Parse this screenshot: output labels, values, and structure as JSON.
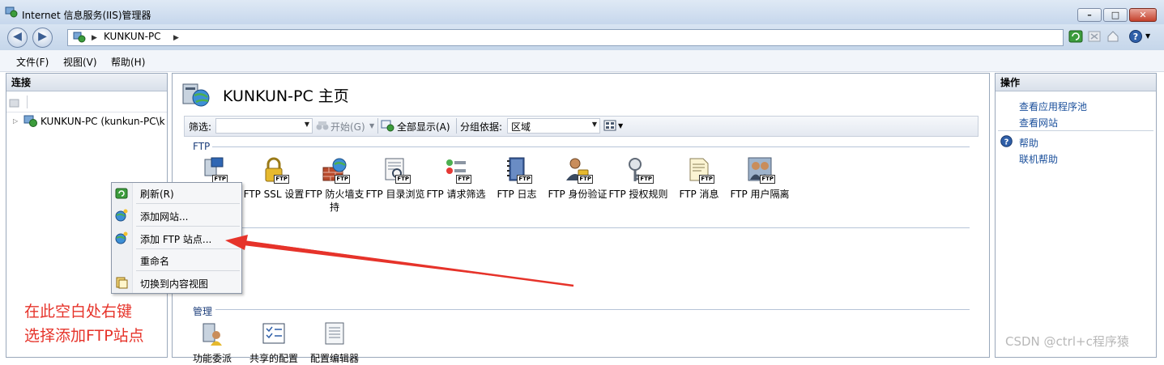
{
  "window": {
    "title": "Internet 信息服务(IIS)管理器",
    "minimize_glyph": "–",
    "maximize_glyph": "□",
    "close_glyph": "✕"
  },
  "address_bar": {
    "separator": "▶",
    "path": "KUNKUN-PC",
    "trailing_separator": "▶"
  },
  "menu": [
    {
      "label": "文件(F)"
    },
    {
      "label": "视图(V)"
    },
    {
      "label": "帮助(H)"
    }
  ],
  "connections": {
    "header": "连接",
    "tree_root": "KUNKUN-PC (kunkun-PC\\kunkun)"
  },
  "center": {
    "title": "KUNKUN-PC 主页",
    "filter_label": "筛选:",
    "filter_value": "",
    "start_label": "开始(G)",
    "show_all_label": "全部显示(A)",
    "group_by_label": "分组依据:",
    "group_by_value": "区域",
    "sections": [
      {
        "label": "FTP",
        "features": [
          {
            "label": "",
            "icon": "ftp-site-icon"
          },
          {
            "label": "FTP SSL 设置",
            "icon": "lock-icon"
          },
          {
            "label": "FTP 防火墙支持",
            "icon": "firewall-icon"
          },
          {
            "label": "FTP 目录浏览",
            "icon": "directory-browse-icon"
          },
          {
            "label": "FTP 请求筛选",
            "icon": "request-filter-icon"
          },
          {
            "label": "FTP 日志",
            "icon": "log-book-icon"
          },
          {
            "label": "FTP 身份验证",
            "icon": "user-lock-icon"
          },
          {
            "label": "FTP 授权规则",
            "icon": "key-icon"
          },
          {
            "label": "FTP 消息",
            "icon": "message-icon"
          },
          {
            "label": "FTP 用户隔离",
            "icon": "user-isolation-icon"
          }
        ]
      },
      {
        "label": "管理",
        "features": [
          {
            "label": "功能委派",
            "icon": "delegation-icon"
          },
          {
            "label": "共享的配置",
            "icon": "shared-config-icon"
          },
          {
            "label": "配置编辑器",
            "icon": "config-editor-icon"
          }
        ]
      }
    ]
  },
  "context_menu": {
    "items": [
      {
        "label": "刷新(R)",
        "icon": "refresh-icon"
      },
      {
        "label": "添加网站...",
        "icon": "add-website-icon"
      },
      {
        "label": "添加 FTP 站点...",
        "icon": "add-ftp-site-icon"
      },
      {
        "label": "重命名",
        "icon": ""
      },
      {
        "label": "切换到内容视图",
        "icon": "content-view-icon"
      }
    ]
  },
  "actions": {
    "header": "操作",
    "links": [
      {
        "label": "查看应用程序池"
      },
      {
        "label": "查看网站"
      }
    ],
    "help_links": [
      {
        "label": "帮助"
      },
      {
        "label": "联机帮助"
      }
    ]
  },
  "annotation": {
    "line1": "在此空白处右键",
    "line2": "选择添加FTP站点",
    "color": "#e6332a"
  },
  "watermark": "CSDN @ctrl+c程序猿"
}
